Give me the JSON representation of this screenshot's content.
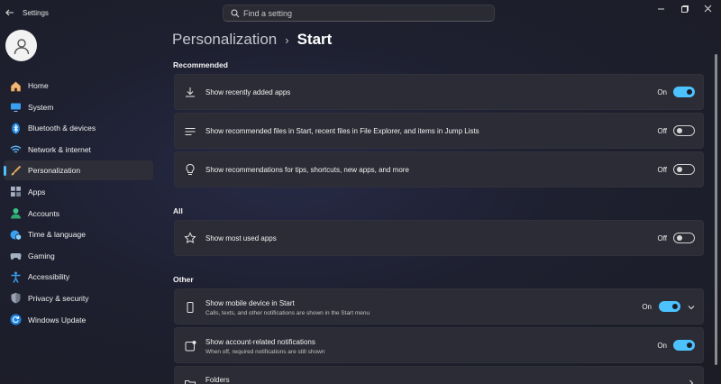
{
  "window": {
    "title": "Settings",
    "search_placeholder": "Find a setting"
  },
  "sidebar": {
    "items": [
      {
        "label": "Home",
        "icon": "home-icon"
      },
      {
        "label": "System",
        "icon": "system-icon"
      },
      {
        "label": "Bluetooth & devices",
        "icon": "bluetooth-icon"
      },
      {
        "label": "Network & internet",
        "icon": "wifi-icon"
      },
      {
        "label": "Personalization",
        "icon": "brush-icon",
        "active": true
      },
      {
        "label": "Apps",
        "icon": "apps-icon"
      },
      {
        "label": "Accounts",
        "icon": "accounts-icon"
      },
      {
        "label": "Time & language",
        "icon": "globe-clock-icon"
      },
      {
        "label": "Gaming",
        "icon": "gamepad-icon"
      },
      {
        "label": "Accessibility",
        "icon": "accessibility-icon"
      },
      {
        "label": "Privacy & security",
        "icon": "shield-icon"
      },
      {
        "label": "Windows Update",
        "icon": "update-icon"
      }
    ]
  },
  "breadcrumb": {
    "parent": "Personalization",
    "separator": "›",
    "current": "Start"
  },
  "sections": {
    "recommended": "Recommended",
    "all": "All",
    "other": "Other"
  },
  "settings": {
    "recently_added": {
      "label": "Show recently added apps",
      "state": "On"
    },
    "recommended_files": {
      "label": "Show recommended files in Start, recent files in File Explorer, and items in Jump Lists",
      "state": "Off"
    },
    "tips": {
      "label": "Show recommendations for tips, shortcuts, new apps, and more",
      "state": "Off"
    },
    "most_used": {
      "label": "Show most used apps",
      "state": "Off"
    },
    "mobile_device": {
      "label": "Show mobile device in Start",
      "sublabel": "Calls, texts, and other notifications are shown in the Start menu",
      "state": "On"
    },
    "account_notifications": {
      "label": "Show account-related notifications",
      "sublabel": "When off, required notifications are still shown",
      "state": "On"
    },
    "folders": {
      "label": "Folders"
    }
  },
  "colors": {
    "accent": "#4cc2ff",
    "card": "#2b2c35",
    "background": "#1d1f2b"
  }
}
